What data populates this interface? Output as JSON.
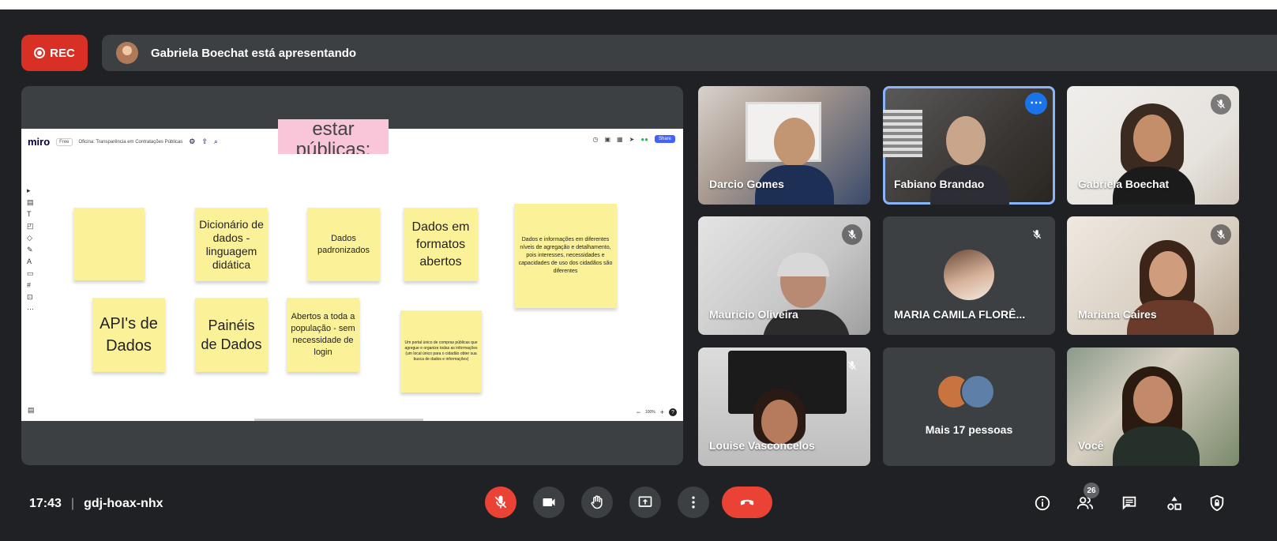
{
  "recording": {
    "label": "REC"
  },
  "presenter_bar": {
    "text": "Gabriela Boechat está apresentando"
  },
  "miro": {
    "logo": "miro",
    "plan_badge": "Free",
    "board_name": "Oficina: Transparência em Contratações Públicas",
    "share_label": "Share",
    "zoom": "100%",
    "pink_note": "estar públicas:",
    "notes": [
      {
        "text": ""
      },
      {
        "text": "Dicionário de dados - linguagem didática"
      },
      {
        "text": "Dados padronizados"
      },
      {
        "text": "Dados em formatos abertos"
      },
      {
        "text": "Dados e informações em diferentes níveis de agregação e detalhamento, pois interesses, necessidades e capacidades de uso dos cidadãos são diferentes"
      },
      {
        "text": "API's de Dados"
      },
      {
        "text": "Painéis de Dados"
      },
      {
        "text": "Abertos a toda a população - sem necessidade de login"
      },
      {
        "text": "Um portal único de compras públicas que agregue e organize todas as informações (um local único para o cidadão obter sua busca de dados e informações)"
      }
    ]
  },
  "participants": [
    {
      "name": "Darcio Gomes",
      "muted": false
    },
    {
      "name": "Fabiano Brandao",
      "muted": false,
      "speaking": true
    },
    {
      "name": "Gabriela Boechat",
      "muted": true
    },
    {
      "name": "Mauricio Oliveira",
      "muted": true
    },
    {
      "name": "MARIA CAMILA FLORÊ...",
      "muted": true
    },
    {
      "name": "Mariana Caires",
      "muted": true
    },
    {
      "name": "Louise Vasconcelos",
      "muted": true
    },
    {
      "name": "Mais 17 pessoas",
      "muted": false
    },
    {
      "name": "Você",
      "muted": false
    }
  ],
  "meeting": {
    "time": "17:43",
    "separator": "|",
    "code": "gdj-hoax-nhx",
    "participant_count": "26"
  },
  "colors": {
    "background": "#202124",
    "tile": "#3c4043",
    "accent_red": "#ea4335",
    "speaking_border": "#8ab4f8",
    "sticky": "#fbf198"
  }
}
